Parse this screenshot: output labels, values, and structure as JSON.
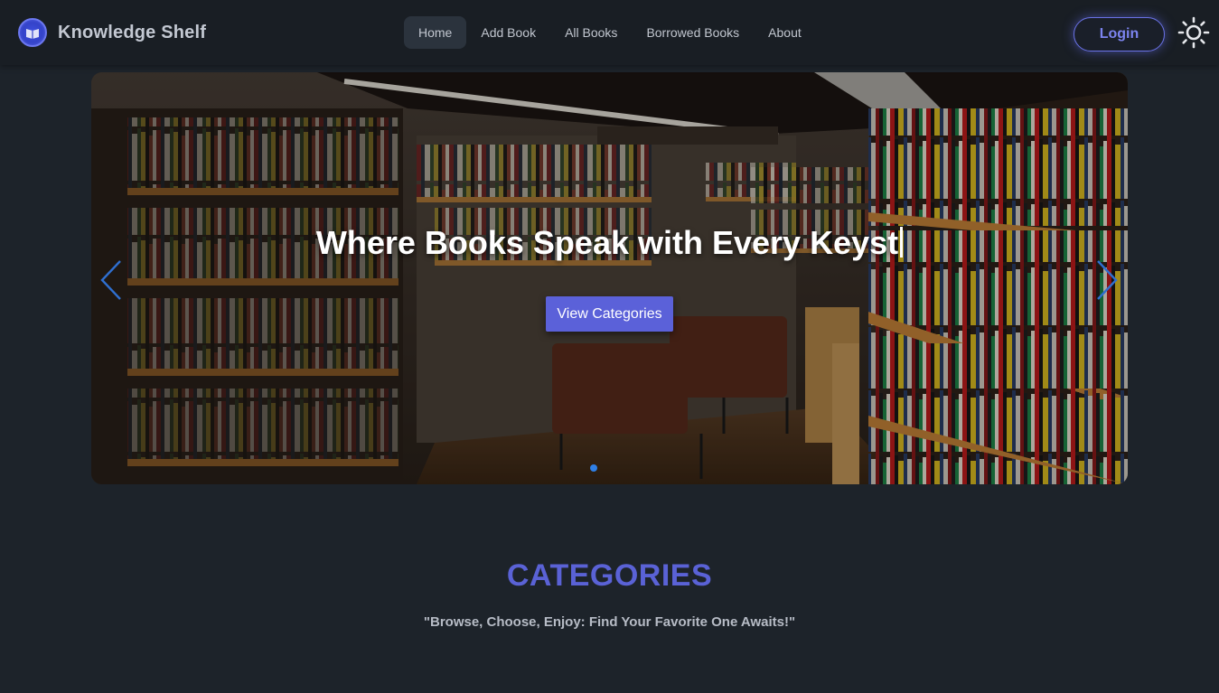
{
  "brand": {
    "name": "Knowledge Shelf",
    "logo_icon": "book-logo-icon"
  },
  "nav": {
    "items": [
      {
        "label": "Home",
        "active": true
      },
      {
        "label": "Add Book",
        "active": false
      },
      {
        "label": "All Books",
        "active": false
      },
      {
        "label": "Borrowed Books",
        "active": false
      },
      {
        "label": "About",
        "active": false
      }
    ],
    "login_label": "Login",
    "theme_icon": "sun-icon"
  },
  "hero": {
    "headline": "Where Books Speak with Every Keyst",
    "cta_label": "View Categories",
    "prev_icon": "chevron-left-icon",
    "next_icon": "chevron-right-icon",
    "slide_count": 1,
    "active_slide": 1
  },
  "categories": {
    "title": "CATEGORIES",
    "subtitle": "\"Browse, Choose, Enjoy: Find Your Favorite One Awaits!\""
  },
  "colors": {
    "page_bg": "#1d232a",
    "navbar_bg": "#191e24",
    "accent": "#5a62d6",
    "active_nav_bg": "#2b333d"
  }
}
